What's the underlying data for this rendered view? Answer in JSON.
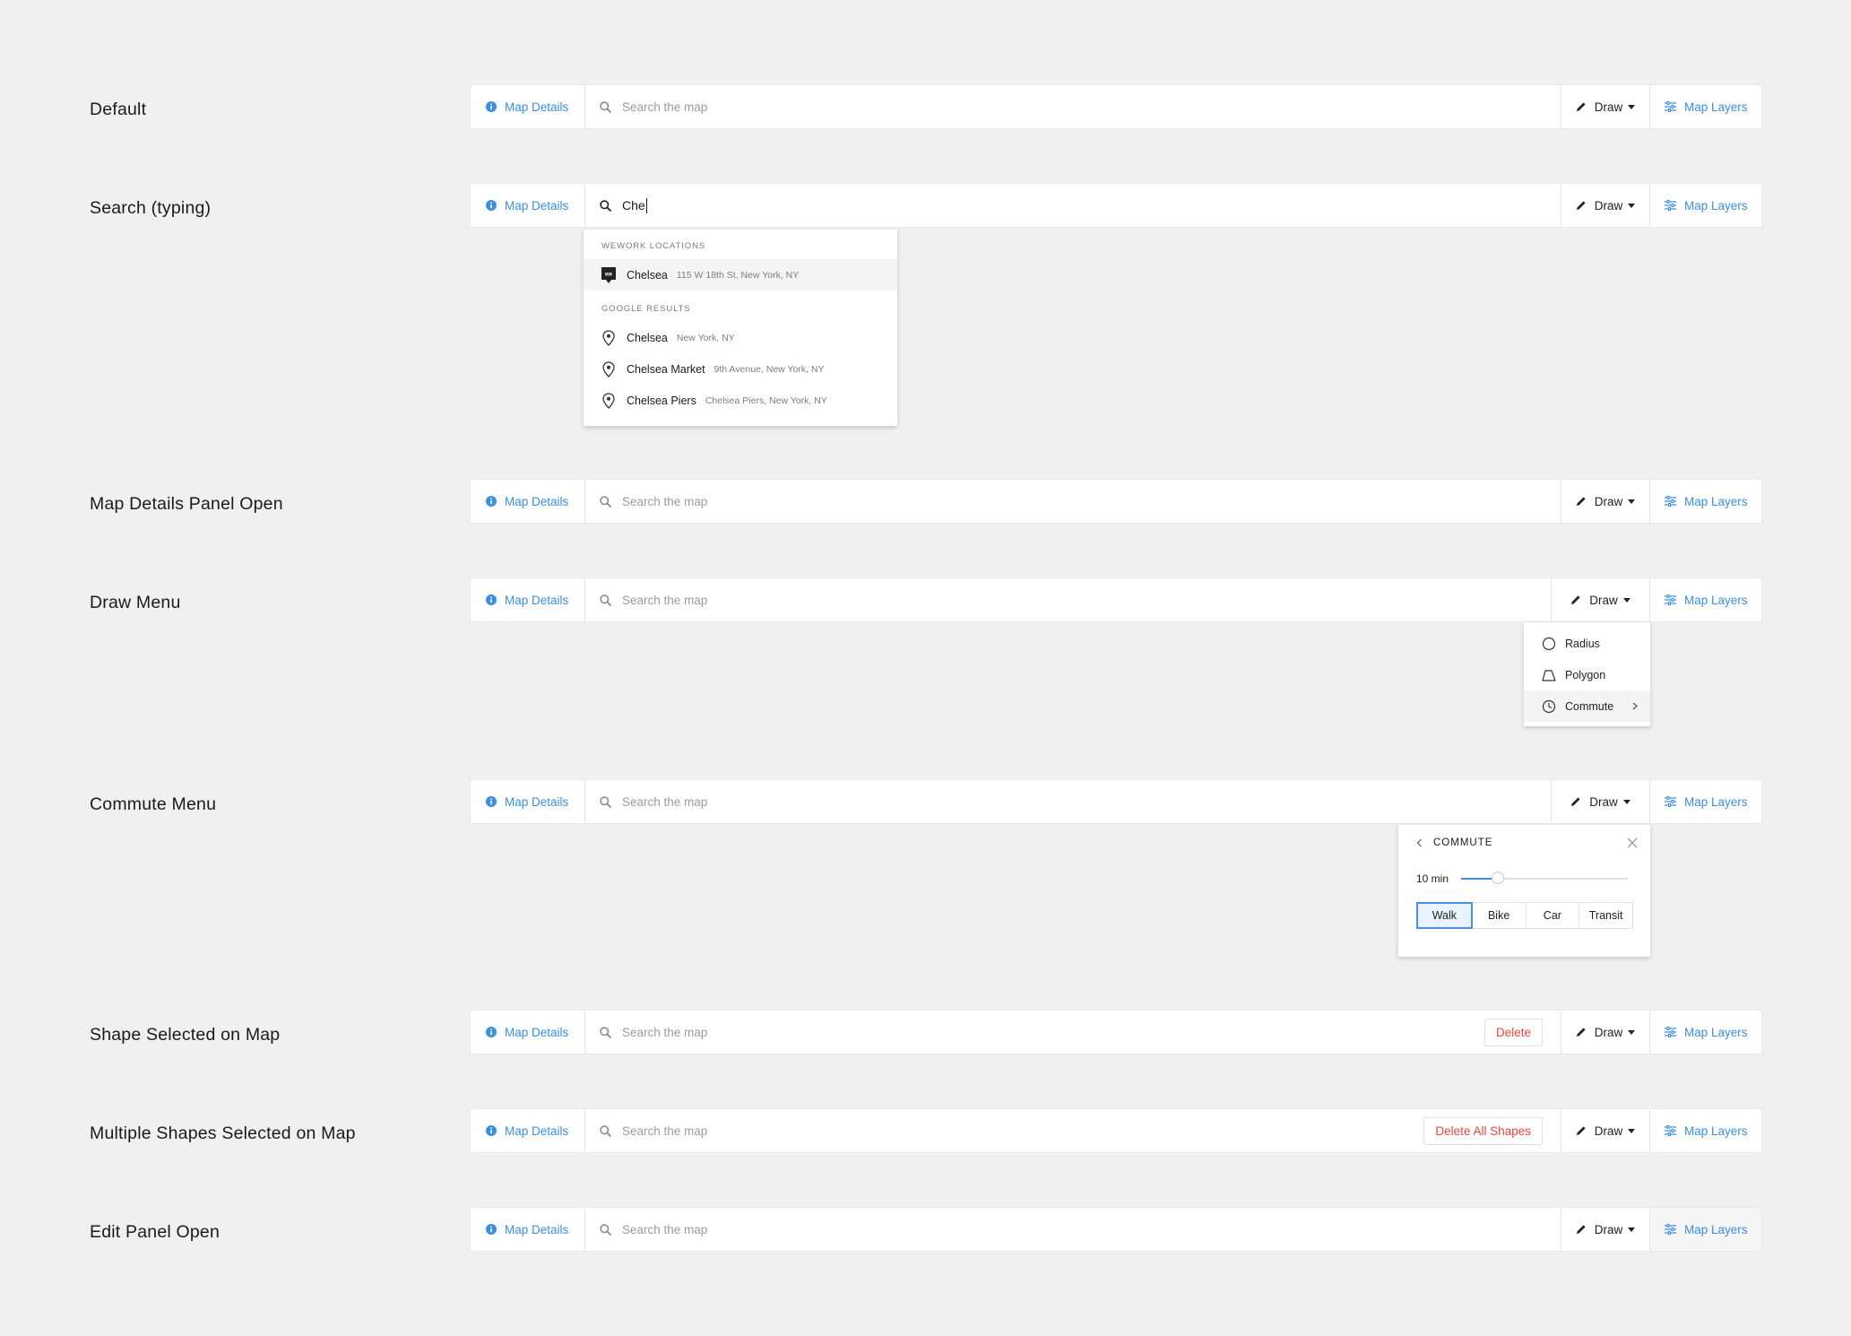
{
  "common": {
    "map_details": "Map Details",
    "search_placeholder": "Search the map",
    "draw": "Draw",
    "map_layers": "Map Layers"
  },
  "rows": [
    {
      "label": "Default"
    },
    {
      "label": "Search (typing)",
      "typed": "Che"
    },
    {
      "label": "Map Details Panel Open"
    },
    {
      "label": "Draw Menu"
    },
    {
      "label": "Commute Menu"
    },
    {
      "label": "Shape Selected on Map",
      "delete_label": "Delete"
    },
    {
      "label": "Multiple Shapes Selected on Map",
      "delete_label": "Delete All Shapes"
    },
    {
      "label": "Edit Panel Open"
    }
  ],
  "search_dropdown": {
    "wework_header": "WEWORK LOCATIONS",
    "wework_items": [
      {
        "name": "Chelsea",
        "sub": "115 W 18th St, New York, NY"
      }
    ],
    "google_header": "GOOGLE RESULTS",
    "google_items": [
      {
        "name": "Chelsea",
        "sub": "New York, NY"
      },
      {
        "name": "Chelsea Market",
        "sub": "9th Avenue, New York, NY"
      },
      {
        "name": "Chelsea Piers",
        "sub": "Chelsea Piers, New York, NY"
      }
    ]
  },
  "draw_menu": {
    "items": [
      "Radius",
      "Polygon",
      "Commute"
    ]
  },
  "commute_panel": {
    "title": "COMMUTE",
    "time_label": "10 min",
    "slider_fraction": 0.22,
    "modes": [
      "Walk",
      "Bike",
      "Car",
      "Transit"
    ],
    "selected_mode": "Walk"
  },
  "colors": {
    "accent": "#3a8ee6",
    "danger": "#e7473c",
    "background": "#f0f0f0"
  }
}
